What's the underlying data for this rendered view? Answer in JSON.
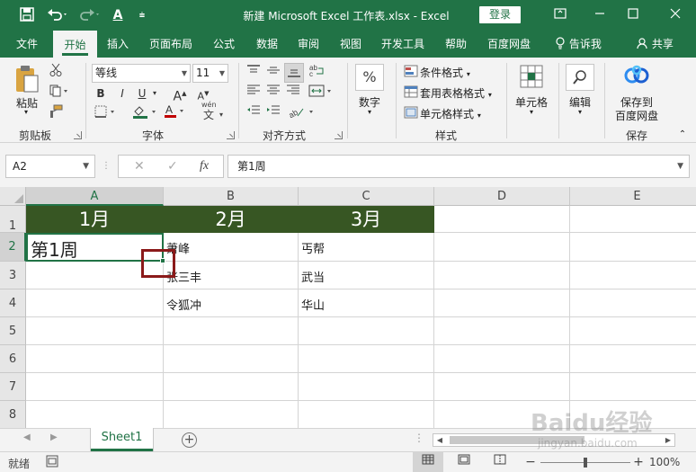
{
  "titlebar": {
    "title": "新建 Microsoft Excel 工作表.xlsx  -  Excel",
    "login": "登录",
    "save_icon": "save-icon",
    "undo_icon": "undo-icon",
    "redo_icon": "redo-icon",
    "fontcolor_glyph": "A",
    "customize_glyph": "⩧"
  },
  "tabs": [
    "文件",
    "开始",
    "插入",
    "页面布局",
    "公式",
    "数据",
    "审阅",
    "视图",
    "开发工具",
    "帮助",
    "百度网盘"
  ],
  "tell_me": "告诉我",
  "share": "共享",
  "ribbon": {
    "clipboard": {
      "paste": "粘贴",
      "label": "剪贴板"
    },
    "font": {
      "name": "等线",
      "size": "11",
      "bold": "B",
      "italic": "I",
      "underline": "U",
      "grow": "A",
      "shrink": "A",
      "label": "字体",
      "wen": "wén"
    },
    "alignment": {
      "label": "对齐方式"
    },
    "number": {
      "percent": "%",
      "label": "数字"
    },
    "styles": {
      "conditional": "条件格式",
      "table": "套用表格格式",
      "cell": "单元格样式",
      "label": "样式"
    },
    "cells": {
      "label": "单元格"
    },
    "editing": {
      "label": "编辑"
    },
    "save": {
      "line1": "保存到",
      "line2": "百度网盘",
      "label": "保存"
    }
  },
  "formula_bar": {
    "name_box": "A2",
    "cancel": "✕",
    "enter": "✓",
    "fx": "fx",
    "value": "第1周"
  },
  "grid": {
    "columns": [
      "A",
      "B",
      "C",
      "D",
      "E"
    ],
    "rows": [
      "1",
      "2",
      "3",
      "4",
      "5",
      "6",
      "7",
      "8"
    ],
    "header_row": [
      "1月",
      "2月",
      "3月"
    ],
    "cells": {
      "A2": "第1周",
      "B2": "萧峰",
      "C2": "丐帮",
      "B3": "张三丰",
      "C3": "武当",
      "B4": "令狐冲",
      "C4": "华山"
    },
    "header_color": "#375623",
    "accent": "#217346"
  },
  "sheet_tabs": [
    "Sheet1"
  ],
  "status": {
    "mode": "就绪",
    "zoom": "100%",
    "minus": "−",
    "plus": "+"
  },
  "watermark": {
    "brand": "Baidu经验",
    "url": "jingyan.baidu.com"
  }
}
